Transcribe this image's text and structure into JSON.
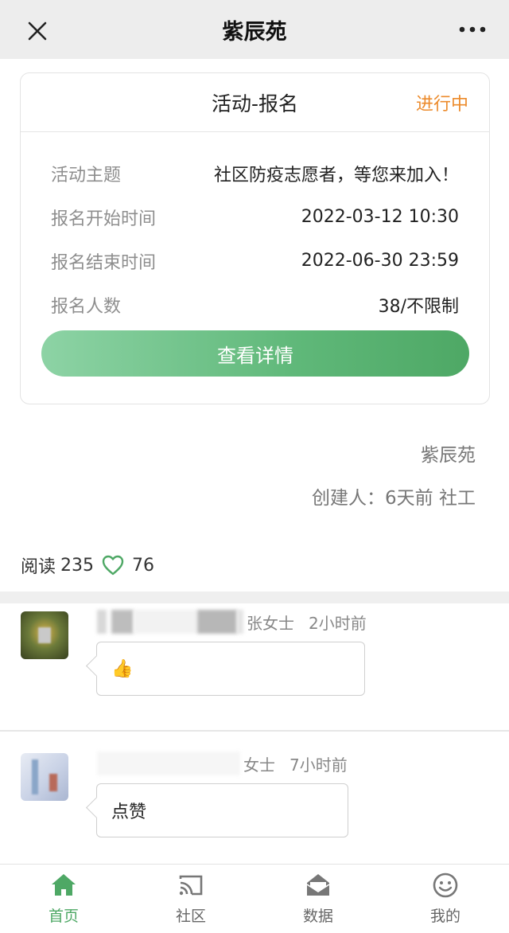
{
  "header": {
    "title": "紫辰苑"
  },
  "activity": {
    "card_title": "活动-报名",
    "status": "进行中",
    "rows": [
      {
        "label": "活动主题",
        "value": "社区防疫志愿者，等您来加入！"
      },
      {
        "label": "报名开始时间",
        "value": "2022-03-12 10:30"
      },
      {
        "label": "报名结束时间",
        "value": "2022-06-30 23:59"
      },
      {
        "label": "报名人数",
        "value": "38/不限制"
      }
    ],
    "detail_button": "查看详情"
  },
  "post_meta": {
    "org": "紫辰苑",
    "creator": "创建人：6天前 社工"
  },
  "stats": {
    "read_label": "阅读",
    "read_count": "235",
    "likes": "76"
  },
  "comments": [
    {
      "name": "张女士",
      "time": "2小时前",
      "content": "👍"
    },
    {
      "name": "女士",
      "time": "7小时前",
      "content": "点赞"
    }
  ],
  "tabbar": {
    "items": [
      {
        "label": "首页",
        "icon": "home-icon",
        "active": true
      },
      {
        "label": "社区",
        "icon": "cast-icon",
        "active": false
      },
      {
        "label": "数据",
        "icon": "mail-icon",
        "active": false
      },
      {
        "label": "我的",
        "icon": "smiley-icon",
        "active": false
      }
    ]
  },
  "colors": {
    "accent": "#4ea865",
    "status": "#ec8b2c"
  }
}
